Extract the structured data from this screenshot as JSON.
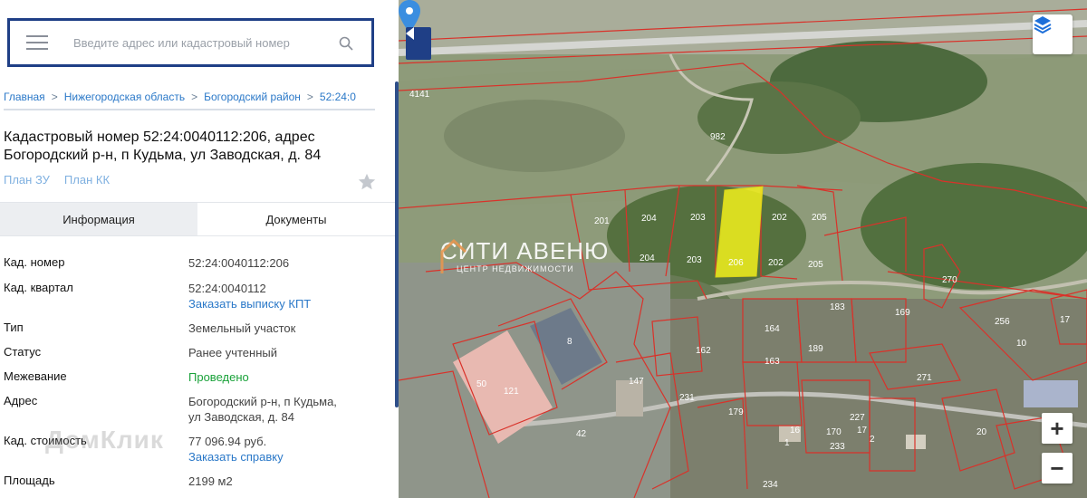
{
  "search": {
    "placeholder": "Введите адрес или кадастровый номер"
  },
  "breadcrumb": [
    "Главная",
    "Нижегородская область",
    "Богородский район",
    "52:24:0"
  ],
  "breadcrumb_separator": ">",
  "title": "Кадастровый номер 52:24:0040112:206, адрес Богородский р-н, п Кудьма, ул Заводская, д. 84",
  "plans": {
    "zu": "План ЗУ",
    "kk": "План КК"
  },
  "tabs": {
    "info": "Информация",
    "docs": "Документы"
  },
  "details": {
    "cad_number": {
      "label": "Кад. номер",
      "value": "52:24:0040112:206"
    },
    "cad_quarter": {
      "label": "Кад. квартал",
      "value": "52:24:0040112",
      "link": "Заказать выписку КПТ"
    },
    "type": {
      "label": "Тип",
      "value": "Земельный участок"
    },
    "status": {
      "label": "Статус",
      "value": "Ранее учтенный"
    },
    "survey": {
      "label": "Межевание",
      "value": "Проведено"
    },
    "address": {
      "label": "Адрес",
      "value_line1": "Богородский р-н, п Кудьма,",
      "value_line2": "ул Заводская, д. 84"
    },
    "cad_cost": {
      "label": "Кад. стоимость",
      "value": "77 096.94 руб.",
      "link": "Заказать справку"
    },
    "area": {
      "label": "Площадь",
      "value": "2199 м2"
    }
  },
  "watermark_left": "ДомКлик",
  "map": {
    "watermark": "СИТИ АВЕНЮ",
    "watermark_sub": "ЦЕНТР НЕДВИЖИМОСТИ",
    "parcel_labels": {
      "p4141": "4141",
      "p982": "982",
      "p201": "201",
      "p204a": "204",
      "p203a": "203",
      "p206a": "",
      "p202a": "202",
      "p205a": "205",
      "p204b": "204",
      "p203b": "203",
      "p206b": "206",
      "p202b": "202",
      "p205b": "205",
      "p270": "270",
      "p256": "256",
      "p17": "17",
      "p10": "10",
      "p164": "164",
      "p163": "163",
      "p162": "162",
      "p189": "189",
      "p183": "183",
      "p169": "169",
      "p271": "271",
      "p50": "50",
      "p121": "121",
      "p8": "8",
      "p42": "42",
      "p147": "147",
      "p231": "231",
      "p179": "179",
      "p227": "227",
      "p233": "233",
      "p170": "170",
      "p20": "20",
      "p234": "234",
      "p17b": "17",
      "p16": "16",
      "p2": "2",
      "p1": "1"
    },
    "colors": {
      "boundary": "#d9322a",
      "selected": "#f2f01c",
      "accent": "#1f3f86",
      "pin": "#3b8ee0"
    }
  },
  "zoom": {
    "in": "+",
    "out": "−"
  }
}
